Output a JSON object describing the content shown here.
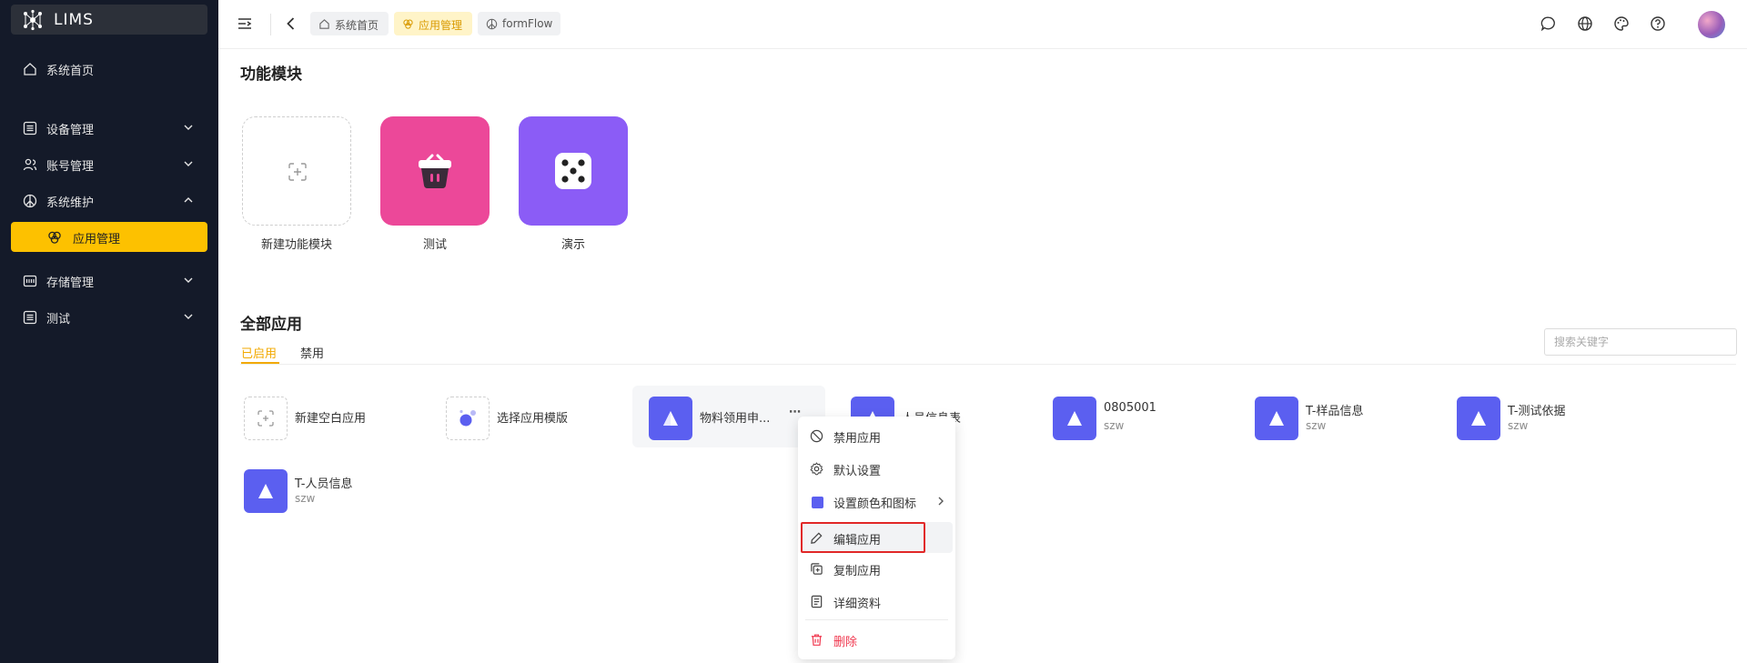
{
  "app": {
    "name": "LIMS"
  },
  "sidebar": {
    "items": [
      {
        "label": "系统首页"
      },
      {
        "label": "设备管理"
      },
      {
        "label": "账号管理"
      },
      {
        "label": "系统维护"
      },
      {
        "label": "应用管理"
      },
      {
        "label": "存储管理"
      },
      {
        "label": "测试"
      }
    ]
  },
  "header": {
    "breadcrumbs": [
      {
        "label": "系统首页"
      },
      {
        "label": "应用管理"
      },
      {
        "label": "formFlow"
      }
    ]
  },
  "modules": {
    "title": "功能模块",
    "items": [
      {
        "label": "新建功能模块"
      },
      {
        "label": "测试"
      },
      {
        "label": "演示"
      }
    ]
  },
  "apps": {
    "title": "全部应用",
    "tabs": [
      {
        "label": "已启用"
      },
      {
        "label": "禁用"
      }
    ],
    "search_placeholder": "搜索关键字",
    "items": [
      {
        "name": "新建空白应用"
      },
      {
        "name": "选择应用模版"
      },
      {
        "name": "物料领用申...",
        "more": "⋯"
      },
      {
        "name": "人员信息表"
      },
      {
        "name": "0805001",
        "owner": "szw"
      },
      {
        "name": "T-样品信息",
        "owner": "szw"
      },
      {
        "name": "T-测试依据",
        "owner": "szw"
      },
      {
        "name": "T-人员信息",
        "owner": "szw"
      }
    ]
  },
  "context_menu": {
    "items": [
      {
        "label": "禁用应用"
      },
      {
        "label": "默认设置"
      },
      {
        "label": "设置颜色和图标"
      },
      {
        "label": "编辑应用"
      },
      {
        "label": "复制应用"
      },
      {
        "label": "详细资料"
      },
      {
        "label": "删除"
      }
    ]
  },
  "colors": {
    "sidebar_bg": "#141a29",
    "accent": "#fdc100",
    "app_icon": "#5b5ff0",
    "module_pink": "#ec4899",
    "module_purple": "#8b5cf6",
    "danger": "#f0384f"
  }
}
